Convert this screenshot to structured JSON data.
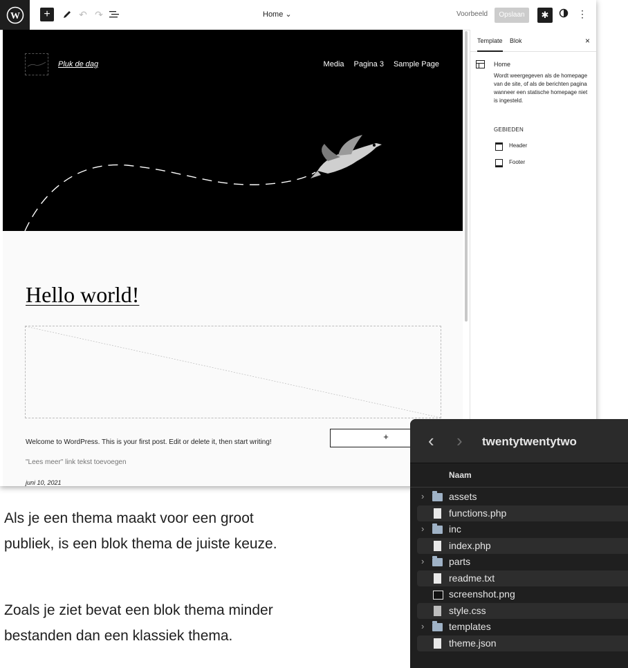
{
  "toolbar": {
    "add_label": "+",
    "template_title": "Home",
    "preview_label": "Voorbeeld",
    "save_label": "Opslaan"
  },
  "site": {
    "title": "Pluk de dag",
    "nav": [
      "Media",
      "Pagina 3",
      "Sample Page"
    ]
  },
  "post": {
    "title": "Hello world!",
    "excerpt": "Welcome to WordPress. This is your first post. Edit or delete it, then start writing!",
    "add_block_label": "+",
    "read_more": "\"Lees meer\" link tekst toevoegen",
    "date": "juni 10, 2021"
  },
  "sidebar": {
    "tabs": [
      "Template",
      "Blok"
    ],
    "close_label": "×",
    "template_name": "Home",
    "description": "Wordt weergegeven als de homepage van de site, of als de berichten pagina wanneer een statische homepage niet is ingesteld.",
    "areas_heading": "GEBIEDEN",
    "areas": [
      "Header",
      "Footer"
    ]
  },
  "body_text": {
    "paragraph_1": [
      "Als je een thema maakt voor een groot",
      "publiek, is een blok thema de juiste keuze."
    ],
    "paragraph_2": [
      "Zoals je ziet bevat een blok thema minder",
      "bestanden dan een klassiek thema."
    ]
  },
  "finder": {
    "title": "twentytwentytwo",
    "column_header": "Naam",
    "items": [
      {
        "name": "assets",
        "type": "folder"
      },
      {
        "name": "functions.php",
        "type": "file"
      },
      {
        "name": "inc",
        "type": "folder"
      },
      {
        "name": "index.php",
        "type": "file"
      },
      {
        "name": "parts",
        "type": "folder"
      },
      {
        "name": "readme.txt",
        "type": "file"
      },
      {
        "name": "screenshot.png",
        "type": "image"
      },
      {
        "name": "style.css",
        "type": "css"
      },
      {
        "name": "templates",
        "type": "folder"
      },
      {
        "name": "theme.json",
        "type": "file"
      }
    ]
  },
  "colors": {
    "hero_bg": "#000000",
    "toolbar_dark": "#1e1e1e",
    "finder_bg": "#1f1f1f"
  }
}
